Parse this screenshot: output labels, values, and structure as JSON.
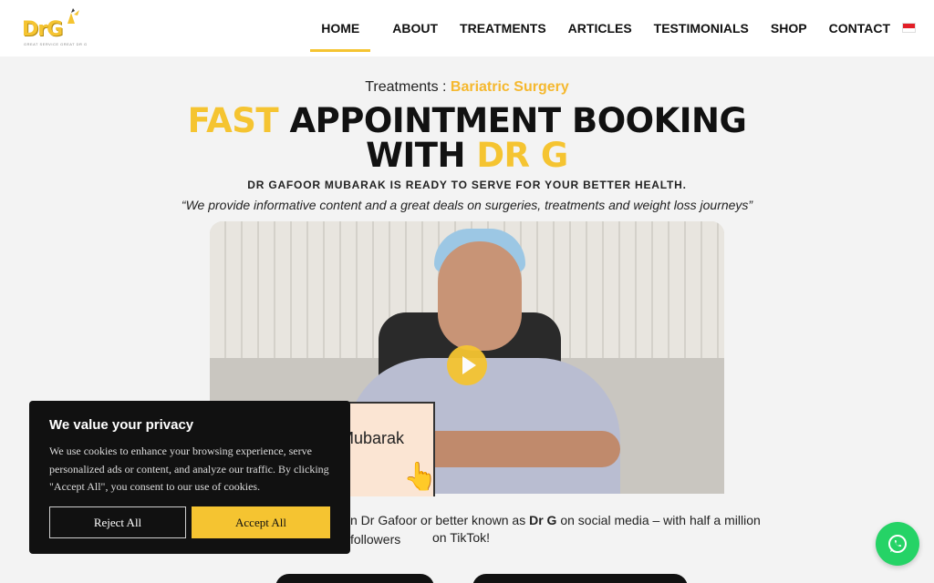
{
  "header": {
    "logo_text": "DrG",
    "logo_tagline": "GREAT SERVICE GREAT DR G",
    "nav": [
      "HOME",
      "ABOUT",
      "TREATMENTS",
      "ARTICLES",
      "TESTIMONIALS",
      "SHOP",
      "CONTACT"
    ],
    "active": "HOME"
  },
  "crumb": {
    "label": "Treatments : ",
    "current": "Bariatric Surgery"
  },
  "headline": {
    "w1": "FAST",
    "w2": " APPOINTMENT BOOKING",
    "w3": "WITH ",
    "w4": "DR G"
  },
  "subheading": "DR GAFOOR MUBARAK IS READY TO SERVE FOR YOUR BETTER HEALTH.",
  "quote": "“We provide informative content and a great deals on surgeries, treatments and weight loss journeys”",
  "video": {
    "nametag": "Mubarak"
  },
  "intro": {
    "line1_pre": "n Dr Gafoor or better known as ",
    "line1_bold": "Dr G",
    "line1_post": " on social media – with half a million followers",
    "line2": "on TikTok!"
  },
  "cookie": {
    "title": "We value your privacy",
    "body": "We use cookies to enhance your browsing experience, serve personalized ads or content, and analyze our traffic. By clicking \"Accept All\", you consent to our use of cookies.",
    "reject": "Reject All",
    "accept": "Accept All"
  },
  "colors": {
    "accent": "#f5c431",
    "whatsapp": "#25d366"
  }
}
